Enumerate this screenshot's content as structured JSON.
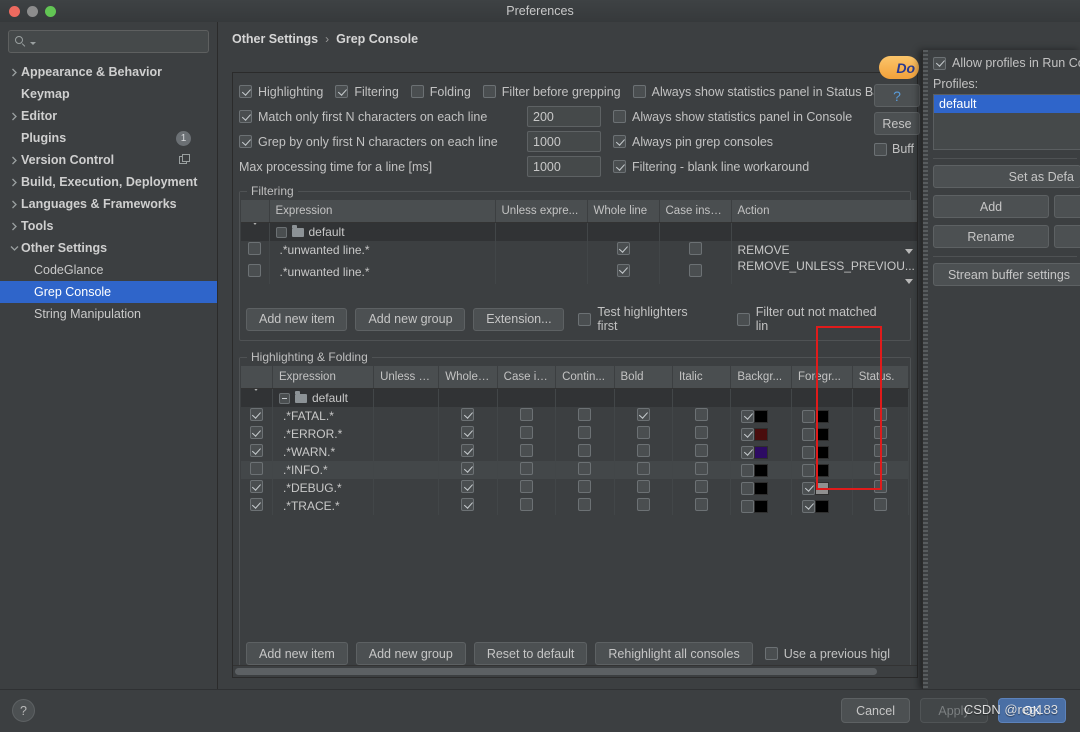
{
  "window": {
    "title": "Preferences"
  },
  "sidebar": {
    "search_placeholder": "",
    "items": [
      {
        "label": "Appearance & Behavior",
        "expandable": true,
        "expanded": false,
        "indent": false,
        "bold": true
      },
      {
        "label": "Keymap",
        "expandable": false,
        "expanded": false,
        "indent": false,
        "bold": true
      },
      {
        "label": "Editor",
        "expandable": true,
        "expanded": false,
        "indent": false,
        "bold": true
      },
      {
        "label": "Plugins",
        "expandable": false,
        "expanded": false,
        "indent": false,
        "bold": true,
        "badge": "1"
      },
      {
        "label": "Version Control",
        "expandable": true,
        "expanded": false,
        "indent": false,
        "bold": true,
        "copy_icon": true
      },
      {
        "label": "Build, Execution, Deployment",
        "expandable": true,
        "expanded": false,
        "indent": false,
        "bold": true
      },
      {
        "label": "Languages & Frameworks",
        "expandable": true,
        "expanded": false,
        "indent": false,
        "bold": true
      },
      {
        "label": "Tools",
        "expandable": true,
        "expanded": false,
        "indent": false,
        "bold": true
      },
      {
        "label": "Other Settings",
        "expandable": true,
        "expanded": true,
        "indent": false,
        "bold": true
      },
      {
        "label": "CodeGlance",
        "expandable": false,
        "indent": true,
        "bold": false
      },
      {
        "label": "Grep Console",
        "expandable": false,
        "indent": true,
        "bold": false,
        "selected": true
      },
      {
        "label": "String Manipulation",
        "expandable": false,
        "indent": true,
        "bold": false
      }
    ]
  },
  "breadcrumb": {
    "parent": "Other Settings",
    "separator": "›",
    "current": "Grep Console"
  },
  "options": {
    "row1": [
      {
        "label": "Highlighting",
        "checked": true
      },
      {
        "label": "Filtering",
        "checked": true
      },
      {
        "label": "Folding",
        "checked": false
      },
      {
        "label": "Filter before grepping",
        "checked": false
      },
      {
        "label": "Always show statistics panel in Status Bar",
        "checked": false
      }
    ],
    "row2": {
      "label": "Match only first N characters on each line",
      "checked": true,
      "value": "200",
      "right": {
        "label": "Always show statistics panel in Console",
        "checked": false
      }
    },
    "row3": {
      "label": "Grep by only first N characters on each line",
      "checked": true,
      "value": "1000",
      "right": {
        "label": "Always pin grep consoles",
        "checked": true
      }
    },
    "row4": {
      "label": "Max processing time for a line [ms]",
      "value": "1000",
      "right": {
        "label": "Filtering - blank line workaround",
        "checked": true
      }
    }
  },
  "side_controls": {
    "donate": "Do",
    "help": "?",
    "reset": "Rese",
    "buffer_checkbox": {
      "label": "Buff",
      "checked": false
    }
  },
  "filtering": {
    "title": "Filtering",
    "columns": [
      "",
      "Expression",
      "Unless expre...",
      "Whole line",
      "Case insen...",
      "Action"
    ],
    "group": {
      "label": "default",
      "checked": false
    },
    "rows": [
      {
        "enabled": false,
        "expression": ".*unwanted line.*",
        "unless": "",
        "whole_line": true,
        "case_insensitive": false,
        "action": "REMOVE"
      },
      {
        "enabled": false,
        "expression": ".*unwanted line.*",
        "unless": "",
        "whole_line": true,
        "case_insensitive": false,
        "action": "REMOVE_UNLESS_PREVIOU..."
      }
    ],
    "buttons": [
      "Add new item",
      "Add new group",
      "Extension..."
    ],
    "checkboxes": [
      {
        "label": "Test highlighters first",
        "checked": false
      },
      {
        "label": "Filter out not matched lin",
        "checked": false
      }
    ]
  },
  "highlighting": {
    "title": "Highlighting & Folding",
    "columns": [
      "",
      "Expression",
      "Unless e...",
      "Whole l...",
      "Case in...",
      "Contin...",
      "Bold",
      "Italic",
      "Backgr...",
      "Foregr...",
      "Status."
    ],
    "group": {
      "label": "default",
      "state": "partial"
    },
    "rows": [
      {
        "enabled": true,
        "expression": ".*FATAL.*",
        "whole_line": true,
        "case_insensitive": false,
        "continue": false,
        "bold": true,
        "italic": false,
        "bg_on": true,
        "bg_color": "#000000",
        "fg_on": false,
        "fg_color": "#000000",
        "status": false,
        "alt": false
      },
      {
        "enabled": true,
        "expression": ".*ERROR.*",
        "whole_line": true,
        "case_insensitive": false,
        "continue": false,
        "bold": false,
        "italic": false,
        "bg_on": true,
        "bg_color": "#4a0d0d",
        "fg_on": false,
        "fg_color": "#000000",
        "status": false,
        "alt": false
      },
      {
        "enabled": true,
        "expression": ".*WARN.*",
        "whole_line": true,
        "case_insensitive": false,
        "continue": false,
        "bold": false,
        "italic": false,
        "bg_on": true,
        "bg_color": "#2d0b63",
        "fg_on": false,
        "fg_color": "#000000",
        "status": false,
        "alt": false
      },
      {
        "enabled": false,
        "expression": ".*INFO.*",
        "whole_line": true,
        "case_insensitive": false,
        "continue": false,
        "bold": false,
        "italic": false,
        "bg_on": false,
        "bg_color": "#000000",
        "fg_on": false,
        "fg_color": "#000000",
        "status": false,
        "alt": true
      },
      {
        "enabled": true,
        "expression": ".*DEBUG.*",
        "whole_line": true,
        "case_insensitive": false,
        "continue": false,
        "bold": false,
        "italic": false,
        "bg_on": false,
        "bg_color": "#000000",
        "fg_on": true,
        "fg_color": "#909090",
        "status": false,
        "alt": false
      },
      {
        "enabled": true,
        "expression": ".*TRACE.*",
        "whole_line": true,
        "case_insensitive": false,
        "continue": false,
        "bold": false,
        "italic": false,
        "bg_on": false,
        "bg_color": "#000000",
        "fg_on": true,
        "fg_color": "#000000",
        "status": false,
        "alt": false
      }
    ],
    "buttons": [
      "Add new item",
      "Add new group",
      "Reset to default",
      "Rehighlight all consoles"
    ],
    "checkbox": {
      "label": "Use a previous higl",
      "checked": false
    },
    "highlight_rect_color": "#e01b1b"
  },
  "overlay_panel": {
    "allow_profiles": {
      "label": "Allow profiles in Run Co",
      "checked": true
    },
    "profiles_label": "Profiles:",
    "profile_selected": "default",
    "buttons": {
      "set_default": "Set as Defa",
      "add": "Add",
      "rename": "Rename",
      "stream_buffer": "Stream buffer settings"
    }
  },
  "footer": {
    "help": "?",
    "cancel": "Cancel",
    "apply": "Apply",
    "ok": "OK",
    "watermark": "CSDN @reg183"
  }
}
